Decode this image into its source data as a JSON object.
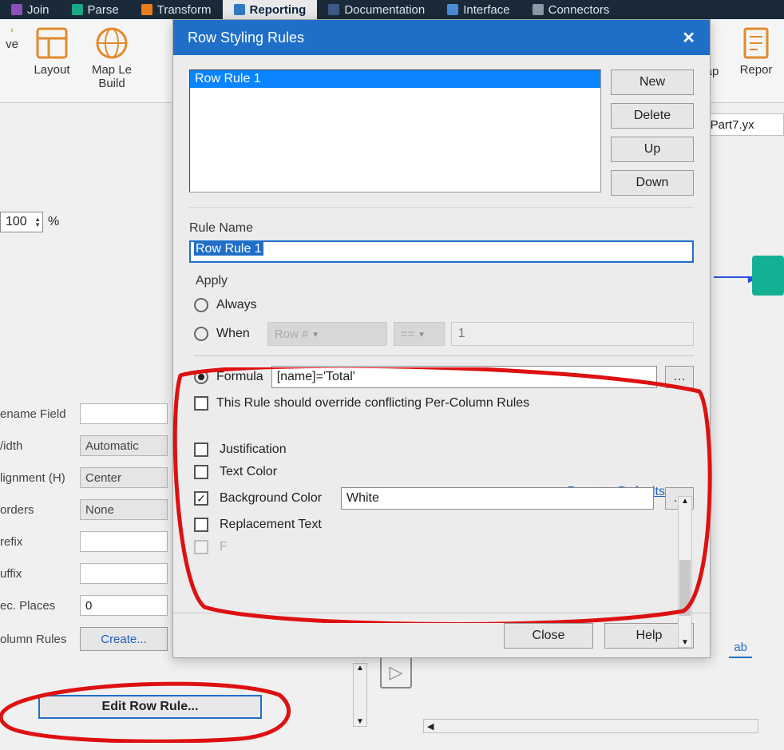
{
  "ribbon": {
    "tabs": [
      "Join",
      "Parse",
      "Transform",
      "Reporting",
      "Documentation",
      "Interface",
      "Connectors"
    ],
    "active": "Reporting",
    "items": {
      "ve": "ve",
      "layout": "Layout",
      "mapBuilder": "Map Le\nBuild",
      "ap": "ap",
      "report": "Repor"
    }
  },
  "docTab": "Part7.yx",
  "bgPanel": {
    "zoom": "100",
    "zoomUnit": "%",
    "renameField": "ename Field",
    "width": "/idth",
    "widthVal": "Automatic",
    "alignment": "lignment (H)",
    "alignmentVal": "Center",
    "borders": "orders",
    "bordersVal": "None",
    "prefix": "refix",
    "suffix": "uffix",
    "decPlaces": "ec. Places",
    "decPlacesVal": "0",
    "columnRules": "olumn Rules",
    "createBtn": "Create...",
    "editRowRule": "Edit Row Rule..."
  },
  "abTab": "ab",
  "dialog": {
    "title": "Row Styling Rules",
    "rules": [
      "Row Rule 1"
    ],
    "buttons": {
      "new": "New",
      "delete": "Delete",
      "up": "Up",
      "down": "Down"
    },
    "ruleNameLabel": "Rule Name",
    "ruleName": "Row Rule 1",
    "applyLabel": "Apply",
    "always": "Always",
    "when": "When",
    "whenField": "Row #",
    "whenOp": "==",
    "whenVal": "1",
    "formula": "Formula",
    "formulaVal": "[name]='Total'",
    "overrideLabel": "This Rule should override conflicting Per-Column Rules",
    "resetLink": "Reset to Defaults",
    "style": {
      "justification": "Justification",
      "textColor": "Text Color",
      "bgColor": "Background Color",
      "bgColorVal": "White",
      "replacement": "Replacement Text",
      "formulaRow": "Formula"
    },
    "close": "Close",
    "help": "Help"
  }
}
